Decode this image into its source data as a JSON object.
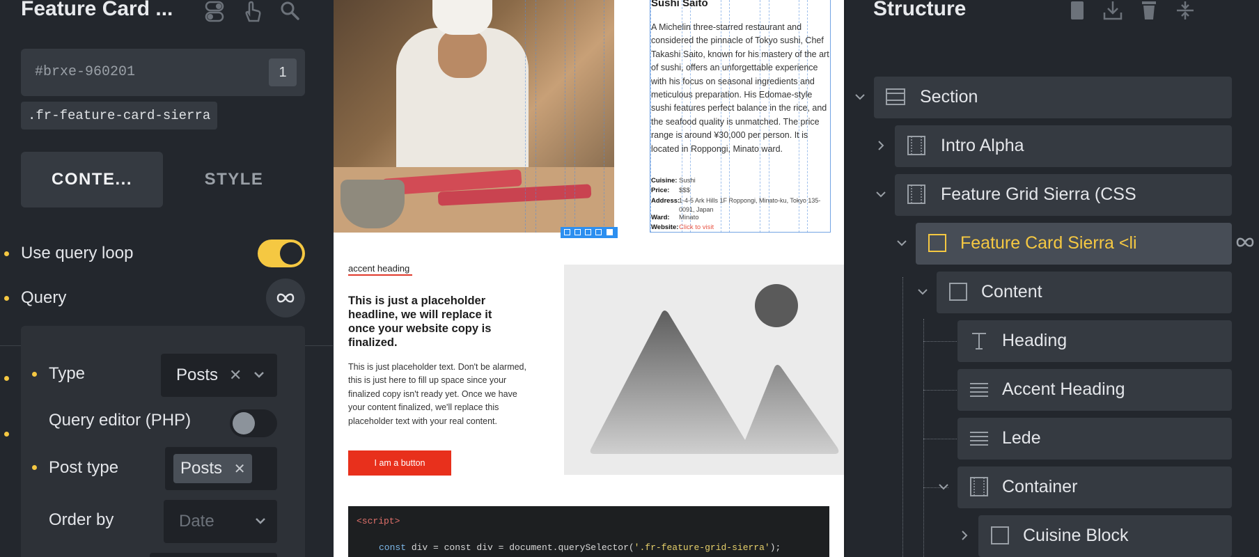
{
  "left_panel": {
    "title": "Feature Card ...",
    "element_id": "#brxe-960201",
    "id_count": "1",
    "class_name": ".fr-feature-card-sierra",
    "tabs": {
      "content": "CONTE...",
      "style": "STYLE"
    },
    "use_query_loop": {
      "label": "Use query loop",
      "enabled": true
    },
    "query": {
      "label": "Query"
    },
    "query_settings": {
      "type": {
        "label": "Type",
        "value": "Posts"
      },
      "query_editor": {
        "label": "Query editor (PHP)",
        "enabled": false
      },
      "post_type": {
        "label": "Post type",
        "value": "Posts"
      },
      "order_by": {
        "label": "Order by",
        "placeholder": "Date"
      }
    }
  },
  "canvas": {
    "restaurant": {
      "title": "Sushi Saito",
      "description": "A Michelin three-starred restaurant and considered the pinnacle of Tokyo sushi, Chef Takashi Saito, known for his mastery of the art of sushi, offers an unforgettable experience with his focus on seasonal ingredients and meticulous preparation. His Edomae-style sushi features perfect balance in the rice, and the seafood quality is unmatched. The price range is around ¥30,000 per person. It is located in Roppongi, Minato ward.",
      "info": [
        {
          "label": "Cuisine:",
          "value": "Sushi"
        },
        {
          "label": "Price:",
          "value": "$$$"
        },
        {
          "label": "Address:",
          "value": "1-4-5 Ark Hills 1F Roppongi, Minato-ku, Tokyo 135-0091, Japan"
        },
        {
          "label": "Ward:",
          "value": "Minato"
        },
        {
          "label": "Website:",
          "value": "Click to visit"
        }
      ]
    },
    "feature": {
      "accent_heading": "accent heading",
      "headline": "This is just a placeholder headline, we will replace it once your website copy is finalized.",
      "body": "This is just placeholder text. Don't be alarmed, this is just here to fill up space since your finalized copy isn't ready yet. Once we have your content finalized, we'll replace this placeholder text with your real content.",
      "button": "I am a button"
    },
    "code": {
      "line1": "<script>",
      "line2_prefix": "const div = document.querySelector(",
      "line2_string": "'.fr-feature-grid-sierra'",
      "line2_suffix": ");"
    }
  },
  "structure": {
    "title": "Structure",
    "nodes": [
      {
        "label": "Section"
      },
      {
        "label": "Intro Alpha"
      },
      {
        "label": "Feature Grid Sierra (CSS"
      },
      {
        "label": "Feature Card Sierra <li"
      },
      {
        "label": "Content"
      },
      {
        "label": "Heading"
      },
      {
        "label": "Accent Heading"
      },
      {
        "label": "Lede"
      },
      {
        "label": "Container"
      },
      {
        "label": "Cuisine Block"
      }
    ]
  },
  "colors": {
    "accent": "#f5c842",
    "panel": "#23272d",
    "button": "#e8301c"
  }
}
